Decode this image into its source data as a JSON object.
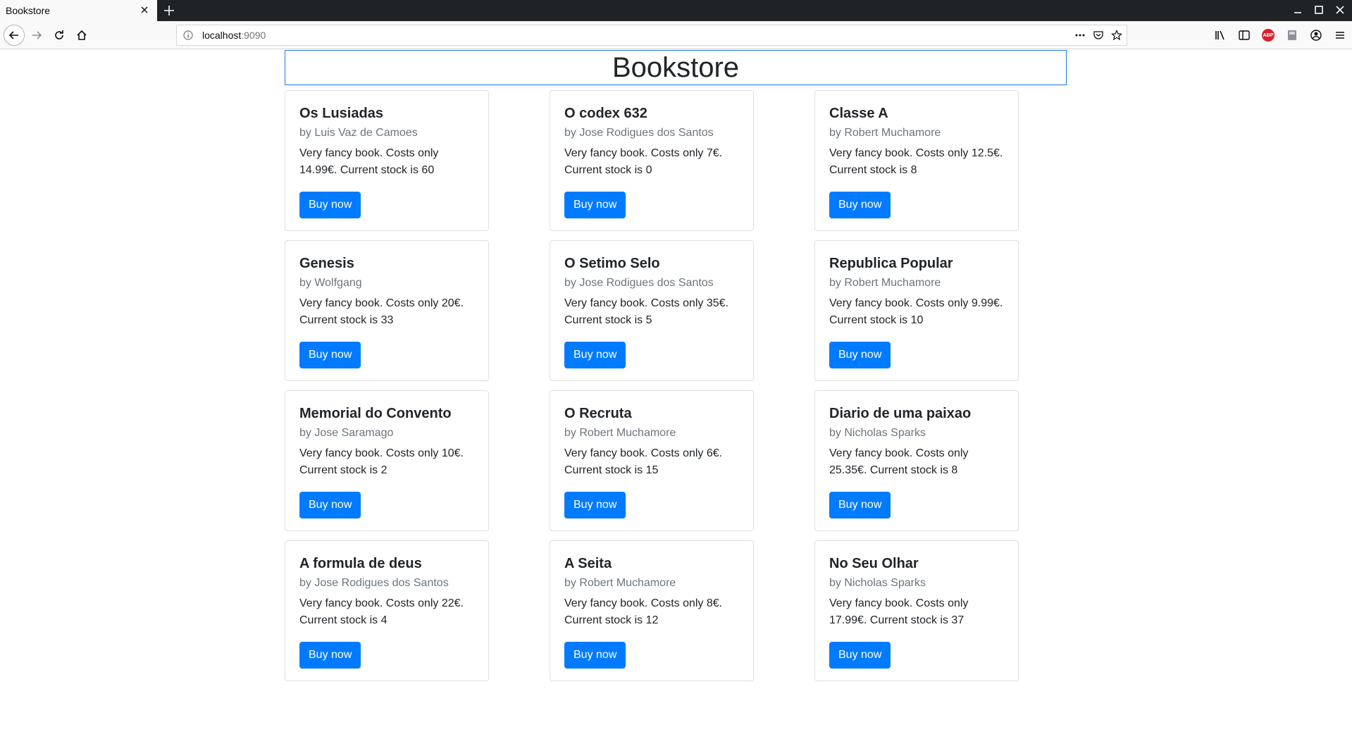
{
  "browser": {
    "tab_title": "Bookstore",
    "url_host": "localhost",
    "url_port": ":9090",
    "abp_label": "ABP"
  },
  "page": {
    "title": "Bookstore",
    "buy_label": "Buy now"
  },
  "books": [
    {
      "title": "Os Lusiadas",
      "author": "by Luis Vaz de Camoes",
      "text": "Very fancy book. Costs only 14.99€. Current stock is 60"
    },
    {
      "title": "O codex 632",
      "author": "by Jose Rodigues dos Santos",
      "text": "Very fancy book. Costs only 7€. Current stock is 0"
    },
    {
      "title": "Classe A",
      "author": "by Robert Muchamore",
      "text": "Very fancy book. Costs only 12.5€. Current stock is 8"
    },
    {
      "title": "Genesis",
      "author": "by Wolfgang",
      "text": "Very fancy book. Costs only 20€. Current stock is 33"
    },
    {
      "title": "O Setimo Selo",
      "author": "by Jose Rodigues dos Santos",
      "text": "Very fancy book. Costs only 35€. Current stock is 5"
    },
    {
      "title": "Republica Popular",
      "author": "by Robert Muchamore",
      "text": "Very fancy book. Costs only 9.99€. Current stock is 10"
    },
    {
      "title": "Memorial do Convento",
      "author": "by Jose Saramago",
      "text": "Very fancy book. Costs only 10€. Current stock is 2"
    },
    {
      "title": "O Recruta",
      "author": "by Robert Muchamore",
      "text": "Very fancy book. Costs only 6€. Current stock is 15"
    },
    {
      "title": "Diario de uma paixao",
      "author": "by Nicholas Sparks",
      "text": "Very fancy book. Costs only 25.35€. Current stock is 8"
    },
    {
      "title": "A formula de deus",
      "author": "by Jose Rodigues dos Santos",
      "text": "Very fancy book. Costs only 22€. Current stock is 4"
    },
    {
      "title": "A Seita",
      "author": "by Robert Muchamore",
      "text": "Very fancy book. Costs only 8€. Current stock is 12"
    },
    {
      "title": "No Seu Olhar",
      "author": "by Nicholas Sparks",
      "text": "Very fancy book. Costs only 17.99€. Current stock is 37"
    }
  ],
  "colors": {
    "primary": "#007bff",
    "header_border": "#1f7ae6",
    "muted": "#6c757d",
    "chrome_dark": "#202326"
  },
  "icons": {
    "tab_close": "close-icon",
    "new_tab": "plus-icon",
    "back": "arrow-left-icon",
    "forward": "arrow-right-icon",
    "reload": "reload-icon",
    "home": "home-icon",
    "info": "info-icon",
    "more": "ellipsis-icon",
    "pocket": "pocket-icon",
    "bookmark": "star-icon",
    "library": "library-icon",
    "sidebar": "sidebar-icon",
    "adblock": "adblock-icon",
    "extension": "extension-icon",
    "account": "account-icon",
    "menu": "hamburger-menu-icon"
  }
}
